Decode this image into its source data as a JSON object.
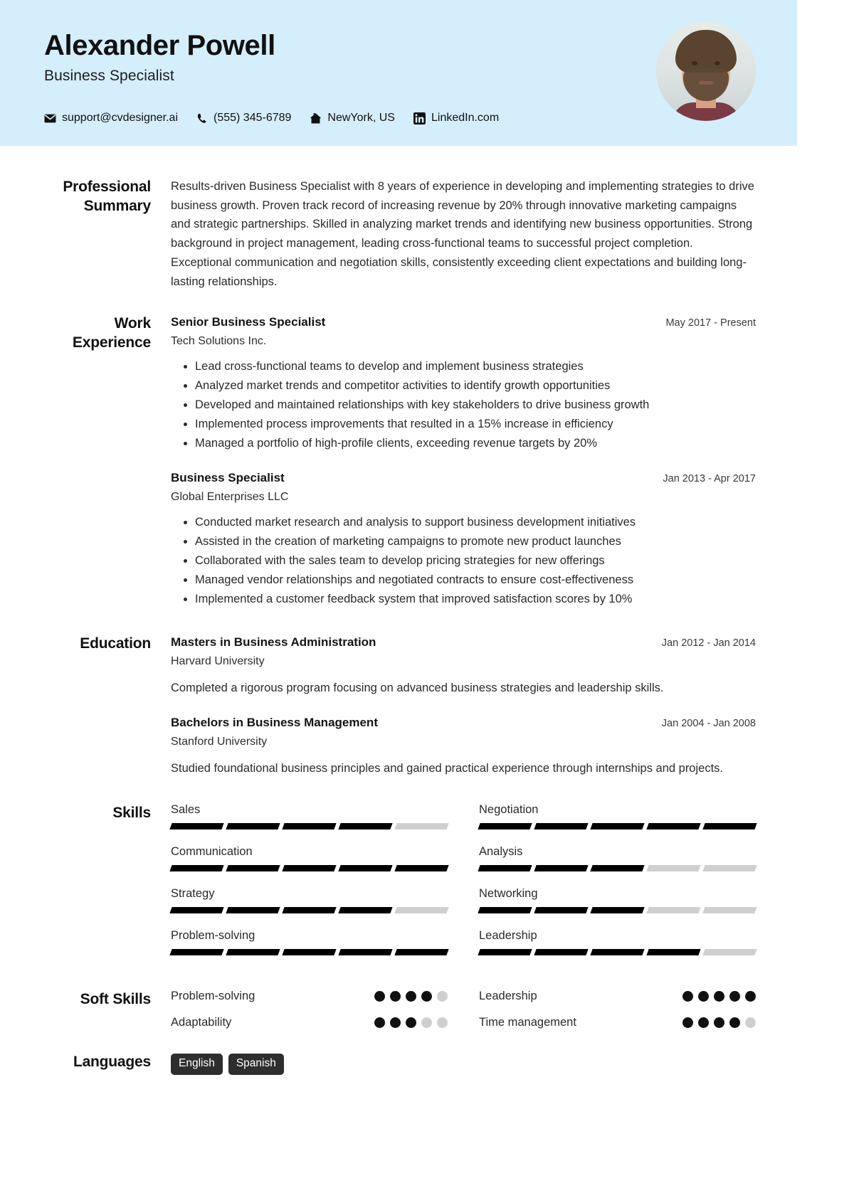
{
  "header": {
    "name": "Alexander Powell",
    "title": "Business Specialist",
    "contacts": [
      {
        "icon": "email-icon",
        "text": "support@cvdesigner.ai"
      },
      {
        "icon": "phone-icon",
        "text": "(555) 345-6789"
      },
      {
        "icon": "home-icon",
        "text": "NewYork, US"
      },
      {
        "icon": "linkedin-icon",
        "text": "LinkedIn.com"
      }
    ],
    "background_color": "#d5eefc",
    "avatar_alt": "profile-photo"
  },
  "sections": {
    "summary": {
      "label": "Professional Summary",
      "text": "Results-driven Business Specialist with 8 years of experience in developing and implementing strategies to drive business growth. Proven track record of increasing revenue by 20% through innovative marketing campaigns and strategic partnerships. Skilled in analyzing market trends and identifying new business opportunities. Strong background in project management, leading cross-functional teams to successful project completion. Exceptional communication and negotiation skills, consistently exceeding client expectations and building long-lasting relationships."
    },
    "work": {
      "label": "Work Experience",
      "entries": [
        {
          "title": "Senior Business Specialist",
          "org": "Tech Solutions Inc.",
          "date": "May 2017 - Present",
          "bullets": [
            "Lead cross-functional teams to develop and implement business strategies",
            "Analyzed market trends and competitor activities to identify growth opportunities",
            "Developed and maintained relationships with key stakeholders to drive business growth",
            "Implemented process improvements that resulted in a 15% increase in efficiency",
            "Managed a portfolio of high-profile clients, exceeding revenue targets by 20%"
          ]
        },
        {
          "title": "Business Specialist",
          "org": "Global Enterprises LLC",
          "date": "Jan 2013 - Apr 2017",
          "bullets": [
            "Conducted market research and analysis to support business development initiatives",
            "Assisted in the creation of marketing campaigns to promote new product launches",
            "Collaborated with the sales team to develop pricing strategies for new offerings",
            "Managed vendor relationships and negotiated contracts to ensure cost-effectiveness",
            "Implemented a customer feedback system that improved satisfaction scores by 10%"
          ]
        }
      ]
    },
    "education": {
      "label": "Education",
      "entries": [
        {
          "title": "Masters in Business Administration",
          "org": "Harvard University",
          "date": "Jan 2012 - Jan 2014",
          "desc": "Completed a rigorous program focusing on advanced business strategies and leadership skills."
        },
        {
          "title": "Bachelors in Business Management",
          "org": "Stanford University",
          "date": "Jan 2004 - Jan 2008",
          "desc": "Studied foundational business principles and gained practical experience through internships and projects."
        }
      ]
    },
    "skills": {
      "label": "Skills",
      "max": 5,
      "items": [
        {
          "name": "Sales",
          "level": 4
        },
        {
          "name": "Negotiation",
          "level": 5
        },
        {
          "name": "Communication",
          "level": 5
        },
        {
          "name": "Analysis",
          "level": 3
        },
        {
          "name": "Strategy",
          "level": 4
        },
        {
          "name": "Networking",
          "level": 3
        },
        {
          "name": "Problem-solving",
          "level": 5
        },
        {
          "name": "Leadership",
          "level": 4
        }
      ]
    },
    "soft_skills": {
      "label": "Soft Skills",
      "max": 5,
      "items": [
        {
          "name": "Problem-solving",
          "level": 4
        },
        {
          "name": "Leadership",
          "level": 5
        },
        {
          "name": "Adaptability",
          "level": 3
        },
        {
          "name": "Time management",
          "level": 4
        }
      ]
    },
    "languages": {
      "label": "Languages",
      "items": [
        "English",
        "Spanish"
      ]
    }
  }
}
